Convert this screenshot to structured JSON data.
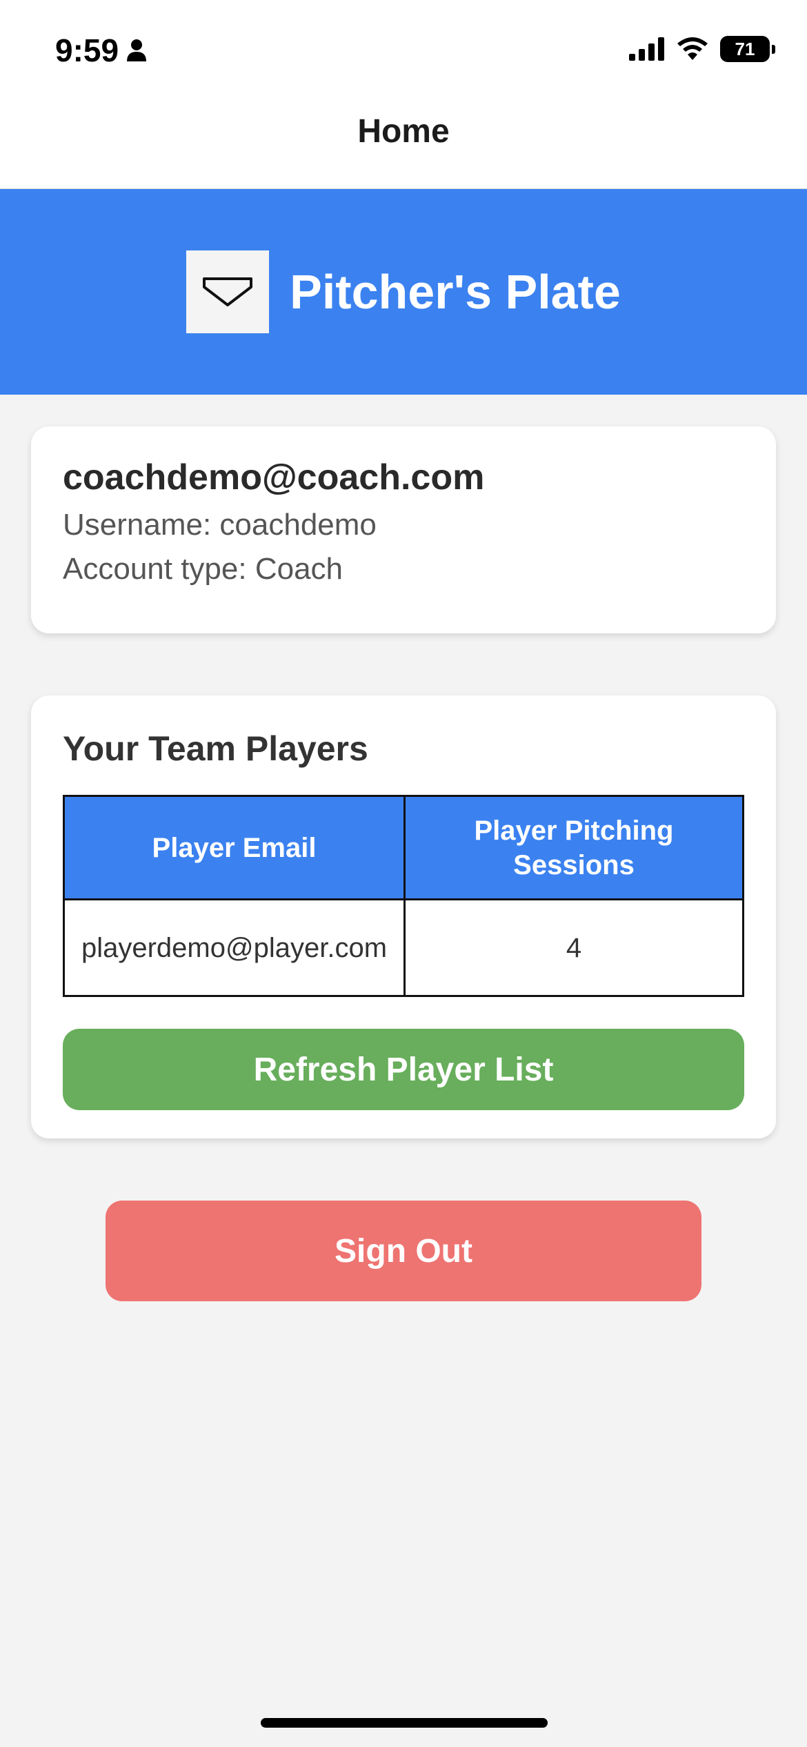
{
  "status_bar": {
    "time": "9:59",
    "battery": "71"
  },
  "nav": {
    "title": "Home"
  },
  "hero": {
    "app_name": "Pitcher's Plate",
    "accent_color": "#3b82f0"
  },
  "account": {
    "email": "coachdemo@coach.com",
    "username_line": "Username: coachdemo",
    "account_type_line": "Account type: Coach"
  },
  "team": {
    "title": "Your Team Players",
    "columns": [
      "Player Email",
      "Player Pitching Sessions"
    ],
    "rows": [
      {
        "email": "playerdemo@player.com",
        "sessions": "4"
      }
    ],
    "refresh_label": "Refresh Player List",
    "refresh_color": "#68ae5c"
  },
  "sign_out": {
    "label": "Sign Out",
    "color": "#ee7472"
  }
}
